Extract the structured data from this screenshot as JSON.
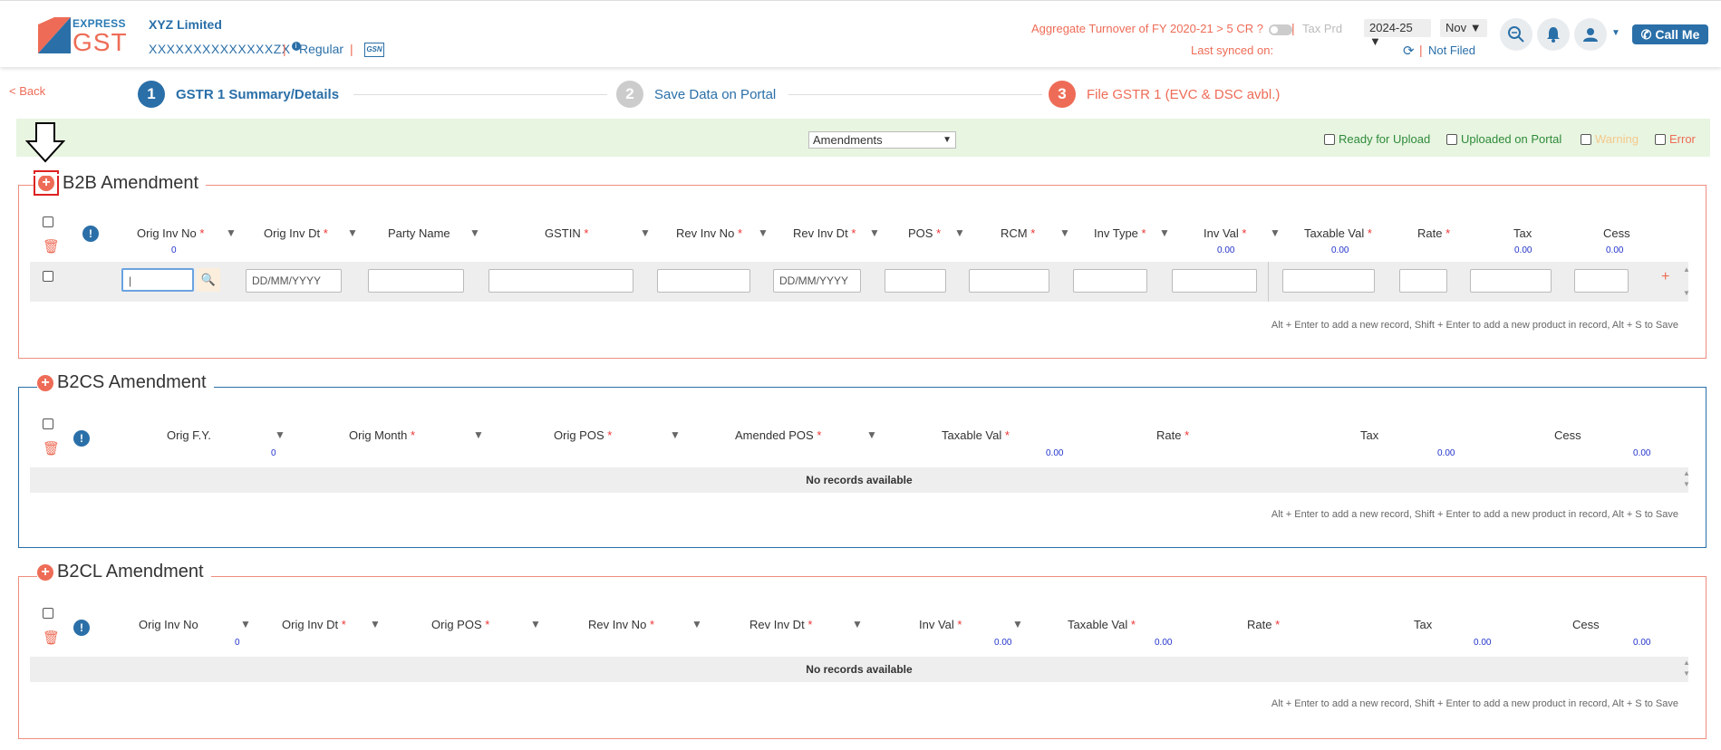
{
  "header": {
    "logo_top": "EXPRESS",
    "logo_bottom": "GST",
    "company": "XYZ Limited",
    "gstin": "XXXXXXXXXXXXXXZX",
    "reg_type": "Regular",
    "gsn_logo": "GSN",
    "aggregate_label": "Aggregate Turnover of FY 2020-21 > 5 CR ?",
    "tax_prd_label": "Tax Prd",
    "year": "2024-25",
    "month": "Nov",
    "last_synced_label": "Last synced on:",
    "status": "Not Filed",
    "call_me": "Call Me",
    "icons": [
      "search-icon",
      "bell-icon",
      "user-icon",
      "phone-icon"
    ]
  },
  "nav": {
    "back": "< Back",
    "steps": [
      {
        "num": "1",
        "label": "GSTR 1 Summary/Details"
      },
      {
        "num": "2",
        "label": "Save Data on Portal"
      },
      {
        "num": "3",
        "label": "File GSTR 1 (EVC & DSC avbl.)"
      }
    ]
  },
  "filter": {
    "selected": "Amendments",
    "legend": [
      "Ready for Upload",
      "Uploaded on Portal",
      "Warning",
      "Error"
    ]
  },
  "b2b": {
    "title": "B2B Amendment",
    "columns": [
      "Orig Inv No",
      "Orig Inv Dt",
      "Party Name",
      "GSTIN",
      "Rev Inv No",
      "Rev Inv Dt",
      "POS",
      "RCM",
      "Inv Type",
      "Inv Val",
      "Taxable Val",
      "Rate",
      "Tax",
      "Cess"
    ],
    "totals": {
      "orig_inv_no": "0",
      "inv_val": "0.00",
      "taxable_val": "0.00",
      "tax": "0.00",
      "cess": "0.00"
    },
    "date_placeholder": "DD/MM/YYYY",
    "help": "Alt + Enter to add a new record, Shift + Enter to add a new product in record, Alt + S to Save"
  },
  "b2cs": {
    "title": "B2CS Amendment",
    "columns": [
      "Orig F.Y.",
      "Orig Month",
      "Orig POS",
      "Amended POS",
      "Taxable Val",
      "Rate",
      "Tax",
      "Cess"
    ],
    "totals": {
      "orig_fy": "0",
      "taxable_val": "0.00",
      "tax": "0.00",
      "cess": "0.00"
    },
    "empty": "No records available",
    "help": "Alt + Enter to add a new record, Shift + Enter to add a new product in record, Alt + S to Save"
  },
  "b2cl": {
    "title": "B2CL Amendment",
    "columns": [
      "Orig Inv No",
      "Orig Inv Dt",
      "Orig POS",
      "Rev Inv No",
      "Rev Inv Dt",
      "Inv Val",
      "Taxable Val",
      "Rate",
      "Tax",
      "Cess"
    ],
    "totals": {
      "orig_inv_no": "0",
      "inv_val": "0.00",
      "taxable_val": "0.00",
      "tax": "0.00",
      "cess": "0.00"
    },
    "empty": "No records available",
    "help": "Alt + Enter to add a new record, Shift + Enter to add a new product in record, Alt + S to Save"
  },
  "colors": {
    "accent": "#2a6fa8",
    "brand_orange": "#ee6c57",
    "green": "#2e8b3a",
    "warning": "#f5c88a",
    "total_blue": "#2233cc"
  }
}
